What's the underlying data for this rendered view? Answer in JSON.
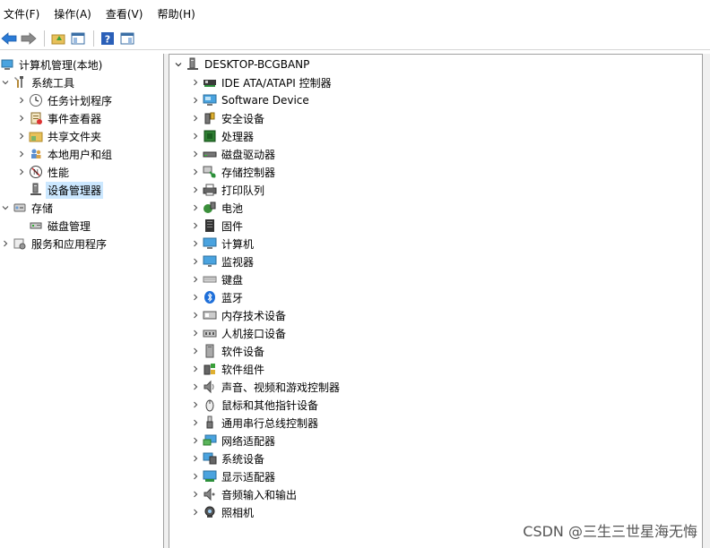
{
  "menubar": {
    "items": [
      "文件(F)",
      "操作(A)",
      "查看(V)",
      "帮助(H)"
    ]
  },
  "toolbar": {
    "buttons": [
      "back-arrow-icon",
      "forward-arrow-icon",
      "up-folder-icon",
      "show-hide-tree-icon",
      "help-icon",
      "properties-icon"
    ]
  },
  "left_tree": {
    "root": "计算机管理(本地)",
    "items": [
      {
        "label": "系统工具",
        "icon": "tools-icon",
        "level": 1,
        "chevron": "down"
      },
      {
        "label": "任务计划程序",
        "icon": "clock-icon",
        "level": 2,
        "chevron": "right"
      },
      {
        "label": "事件查看器",
        "icon": "event-log-icon",
        "level": 2,
        "chevron": "right"
      },
      {
        "label": "共享文件夹",
        "icon": "shared-folder-icon",
        "level": 2,
        "chevron": "right"
      },
      {
        "label": "本地用户和组",
        "icon": "users-icon",
        "level": 2,
        "chevron": "right"
      },
      {
        "label": "性能",
        "icon": "performance-icon",
        "level": 2,
        "chevron": "right"
      },
      {
        "label": "设备管理器",
        "icon": "device-manager-icon",
        "level": 2,
        "chevron": "none",
        "selected": true
      },
      {
        "label": "存储",
        "icon": "storage-icon",
        "level": 1,
        "chevron": "down"
      },
      {
        "label": "磁盘管理",
        "icon": "disk-management-icon",
        "level": 2,
        "chevron": "none"
      },
      {
        "label": "服务和应用程序",
        "icon": "services-icon",
        "level": 1,
        "chevron": "right"
      }
    ]
  },
  "device_tree": {
    "root": "DESKTOP-BCGBANP",
    "items": [
      {
        "label": "IDE ATA/ATAPI 控制器",
        "icon": "ide-controller-icon"
      },
      {
        "label": "Software Device",
        "icon": "software-device-icon"
      },
      {
        "label": "安全设备",
        "icon": "security-device-icon"
      },
      {
        "label": "处理器",
        "icon": "processor-icon"
      },
      {
        "label": "磁盘驱动器",
        "icon": "disk-drive-icon"
      },
      {
        "label": "存储控制器",
        "icon": "storage-controller-icon"
      },
      {
        "label": "打印队列",
        "icon": "printer-icon"
      },
      {
        "label": "电池",
        "icon": "battery-icon"
      },
      {
        "label": "固件",
        "icon": "firmware-icon"
      },
      {
        "label": "计算机",
        "icon": "computer-icon"
      },
      {
        "label": "监视器",
        "icon": "monitor-icon"
      },
      {
        "label": "键盘",
        "icon": "keyboard-icon"
      },
      {
        "label": "蓝牙",
        "icon": "bluetooth-icon"
      },
      {
        "label": "内存技术设备",
        "icon": "memory-device-icon"
      },
      {
        "label": "人机接口设备",
        "icon": "hid-icon"
      },
      {
        "label": "软件设备",
        "icon": "software-component-icon"
      },
      {
        "label": "软件组件",
        "icon": "software-module-icon"
      },
      {
        "label": "声音、视频和游戏控制器",
        "icon": "speaker-icon"
      },
      {
        "label": "鼠标和其他指针设备",
        "icon": "mouse-icon"
      },
      {
        "label": "通用串行总线控制器",
        "icon": "usb-icon"
      },
      {
        "label": "网络适配器",
        "icon": "network-adapter-icon"
      },
      {
        "label": "系统设备",
        "icon": "system-device-icon"
      },
      {
        "label": "显示适配器",
        "icon": "display-adapter-icon"
      },
      {
        "label": "音频输入和输出",
        "icon": "audio-io-icon"
      },
      {
        "label": "照相机",
        "icon": "camera-icon"
      }
    ]
  },
  "watermark": "CSDN @三生三世星海无悔",
  "colors": {
    "selection": "#cce8ff",
    "border": "#a0a0a0",
    "accent_blue": "#1e6fd9"
  }
}
